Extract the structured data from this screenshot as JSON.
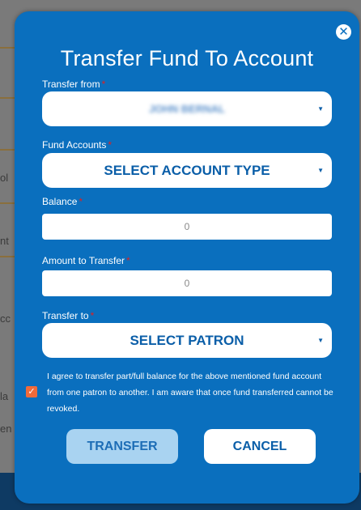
{
  "background": {
    "fragments": [
      "ol",
      "nt",
      "cc",
      "la",
      "en"
    ]
  },
  "modal": {
    "title": "Transfer Fund To Account",
    "close_icon": "close-icon",
    "transfer_from": {
      "label": "Transfer from",
      "required_mark": "*",
      "value": "JOHN BERNAL"
    },
    "fund_accounts": {
      "label": "Fund Accounts",
      "required_mark": "*",
      "value": "SELECT ACCOUNT TYPE"
    },
    "balance": {
      "label": "Balance",
      "required_mark": "*",
      "value": "0"
    },
    "amount_to_transfer": {
      "label": "Amount to Transfer",
      "required_mark": "*",
      "value": "0"
    },
    "transfer_to": {
      "label": "Transfer to",
      "required_mark": "*",
      "value": "SELECT PATRON"
    },
    "agreement": {
      "checked": true,
      "text": "I agree to transfer part/full balance for the above mentioned fund account from one patron to another. I am aware that once fund transferred cannot be revoked."
    },
    "buttons": {
      "transfer_label": "TRANSFER",
      "cancel_label": "CANCEL"
    }
  },
  "colors": {
    "modal_bg": "#0a6fbe",
    "checkbox": "#f06a3a",
    "required": "#e02020",
    "transfer_button_bg": "#a9d3f1"
  }
}
